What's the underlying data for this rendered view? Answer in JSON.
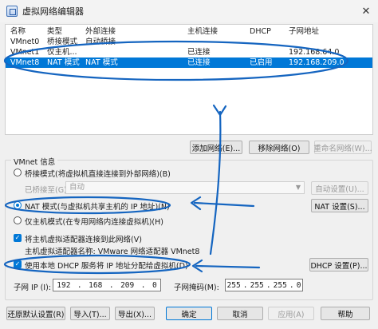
{
  "window": {
    "title": "虚拟网络编辑器",
    "close_glyph": "✕"
  },
  "network_table": {
    "columns": [
      "名称",
      "类型",
      "外部连接",
      "主机连接",
      "DHCP",
      "子网地址"
    ],
    "rows": [
      {
        "name": "VMnet0",
        "type": "桥接模式",
        "external": "自动桥接",
        "host": "",
        "dhcp": "",
        "subnet": ""
      },
      {
        "name": "VMnet1",
        "type": "仅主机...",
        "external": "",
        "host": "已连接",
        "dhcp": "",
        "subnet": "192.168.64.0"
      },
      {
        "name": "VMnet8",
        "type": "NAT 模式",
        "external": "NAT 模式",
        "host": "已连接",
        "dhcp": "已启用",
        "subnet": "192.168.209.0"
      }
    ],
    "selected_index": 2
  },
  "table_buttons": {
    "add": "添加网络(E)...",
    "remove": "移除网络(O)",
    "rename": "重命名网络(W)..."
  },
  "vmnet_info": {
    "label": "VMnet 信息",
    "bridge_radio": "桥接模式(将虚拟机直接连接到外部网络)(B)",
    "bridged_to_label": "已桥接至(G):",
    "bridged_to_value": "自动",
    "auto_settings_button": "自动设置(U)...",
    "nat_radio": "NAT 模式(与虚拟机共享主机的 IP 地址)(N)",
    "nat_settings_button": "NAT 设置(S)...",
    "hostonly_radio": "仅主机模式(在专用网络内连接虚拟机)(H)",
    "connect_adapter_check": "将主机虚拟适配器连接到此网络(V)",
    "adapter_name_text": "主机虚拟适配器名称: VMware 网络适配器 VMnet8",
    "dhcp_check": "使用本地 DHCP 服务将 IP 地址分配给虚拟机(D)",
    "dhcp_settings_button": "DHCP 设置(P)...",
    "subnet_ip_label": "子网 IP (I):",
    "subnet_ip": [
      "192",
      "168",
      "209",
      "0"
    ],
    "subnet_mask_label": "子网掩码(M):",
    "subnet_mask": [
      "255",
      "255",
      "255",
      "0"
    ]
  },
  "footer": {
    "restore": "还原默认设置(R)",
    "import": "导入(T)...",
    "export": "导出(X)...",
    "ok": "确定",
    "cancel": "取消",
    "apply": "应用(A)",
    "help": "帮助"
  },
  "checked_glyph": "✓",
  "ip_sep": ".",
  "annotation_color": "#1565c0"
}
